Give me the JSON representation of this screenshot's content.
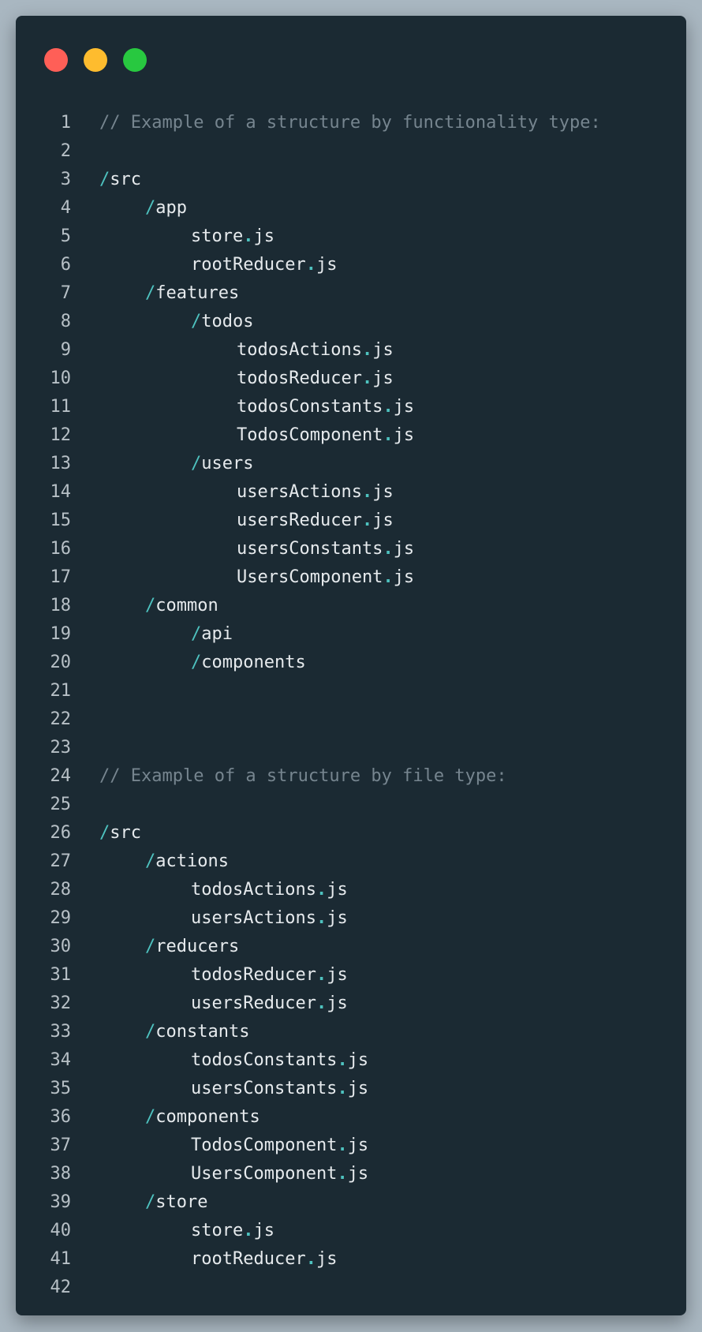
{
  "window": {
    "controls": [
      {
        "name": "close-button",
        "color": "#ff5f57"
      },
      {
        "name": "minimize-button",
        "color": "#febc2e"
      },
      {
        "name": "maximize-button",
        "color": "#28c840"
      }
    ]
  },
  "colors": {
    "background": "#a9b7c1",
    "editor": "#1b2a33",
    "text": "#e6eaed",
    "comment": "#76858f",
    "accent": "#4ec2bf",
    "line_number": "#b7c0c6"
  },
  "code_lines": [
    {
      "n": "1",
      "text": "// Example of a structure by functionality type:",
      "indent": 0,
      "kind": "comment"
    },
    {
      "n": "2",
      "text": "",
      "indent": 0,
      "kind": "blank"
    },
    {
      "n": "3",
      "text": "src",
      "indent": 0,
      "kind": "dir"
    },
    {
      "n": "4",
      "text": "app",
      "indent": 1,
      "kind": "dir"
    },
    {
      "n": "5",
      "text": "store.js",
      "indent": 2,
      "kind": "file"
    },
    {
      "n": "6",
      "text": "rootReducer.js",
      "indent": 2,
      "kind": "file"
    },
    {
      "n": "7",
      "text": "features",
      "indent": 1,
      "kind": "dir"
    },
    {
      "n": "8",
      "text": "todos",
      "indent": 2,
      "kind": "dir"
    },
    {
      "n": "9",
      "text": "todosActions.js",
      "indent": 3,
      "kind": "file"
    },
    {
      "n": "10",
      "text": "todosReducer.js",
      "indent": 3,
      "kind": "file"
    },
    {
      "n": "11",
      "text": "todosConstants.js",
      "indent": 3,
      "kind": "file"
    },
    {
      "n": "12",
      "text": "TodosComponent.js",
      "indent": 3,
      "kind": "file"
    },
    {
      "n": "13",
      "text": "users",
      "indent": 2,
      "kind": "dir"
    },
    {
      "n": "14",
      "text": "usersActions.js",
      "indent": 3,
      "kind": "file"
    },
    {
      "n": "15",
      "text": "usersReducer.js",
      "indent": 3,
      "kind": "file"
    },
    {
      "n": "16",
      "text": "usersConstants.js",
      "indent": 3,
      "kind": "file"
    },
    {
      "n": "17",
      "text": "UsersComponent.js",
      "indent": 3,
      "kind": "file"
    },
    {
      "n": "18",
      "text": "common",
      "indent": 1,
      "kind": "dir"
    },
    {
      "n": "19",
      "text": "api",
      "indent": 2,
      "kind": "dir"
    },
    {
      "n": "20",
      "text": "components",
      "indent": 2,
      "kind": "dir"
    },
    {
      "n": "21",
      "text": "",
      "indent": 0,
      "kind": "blank"
    },
    {
      "n": "22",
      "text": "",
      "indent": 0,
      "kind": "blank"
    },
    {
      "n": "23",
      "text": "",
      "indent": 0,
      "kind": "blank"
    },
    {
      "n": "24",
      "text": "// Example of a structure by file type:",
      "indent": 0,
      "kind": "comment"
    },
    {
      "n": "25",
      "text": "",
      "indent": 0,
      "kind": "blank"
    },
    {
      "n": "26",
      "text": "src",
      "indent": 0,
      "kind": "dir"
    },
    {
      "n": "27",
      "text": "actions",
      "indent": 1,
      "kind": "dir"
    },
    {
      "n": "28",
      "text": "todosActions.js",
      "indent": 2,
      "kind": "file"
    },
    {
      "n": "29",
      "text": "usersActions.js",
      "indent": 2,
      "kind": "file"
    },
    {
      "n": "30",
      "text": "reducers",
      "indent": 1,
      "kind": "dir"
    },
    {
      "n": "31",
      "text": "todosReducer.js",
      "indent": 2,
      "kind": "file"
    },
    {
      "n": "32",
      "text": "usersReducer.js",
      "indent": 2,
      "kind": "file"
    },
    {
      "n": "33",
      "text": "constants",
      "indent": 1,
      "kind": "dir"
    },
    {
      "n": "34",
      "text": "todosConstants.js",
      "indent": 2,
      "kind": "file"
    },
    {
      "n": "35",
      "text": "usersConstants.js",
      "indent": 2,
      "kind": "file"
    },
    {
      "n": "36",
      "text": "components",
      "indent": 1,
      "kind": "dir"
    },
    {
      "n": "37",
      "text": "TodosComponent.js",
      "indent": 2,
      "kind": "file"
    },
    {
      "n": "38",
      "text": "UsersComponent.js",
      "indent": 2,
      "kind": "file"
    },
    {
      "n": "39",
      "text": "store",
      "indent": 1,
      "kind": "dir"
    },
    {
      "n": "40",
      "text": "store.js",
      "indent": 2,
      "kind": "file"
    },
    {
      "n": "41",
      "text": "rootReducer.js",
      "indent": 2,
      "kind": "file"
    },
    {
      "n": "42",
      "text": "",
      "indent": 0,
      "kind": "blank"
    }
  ]
}
